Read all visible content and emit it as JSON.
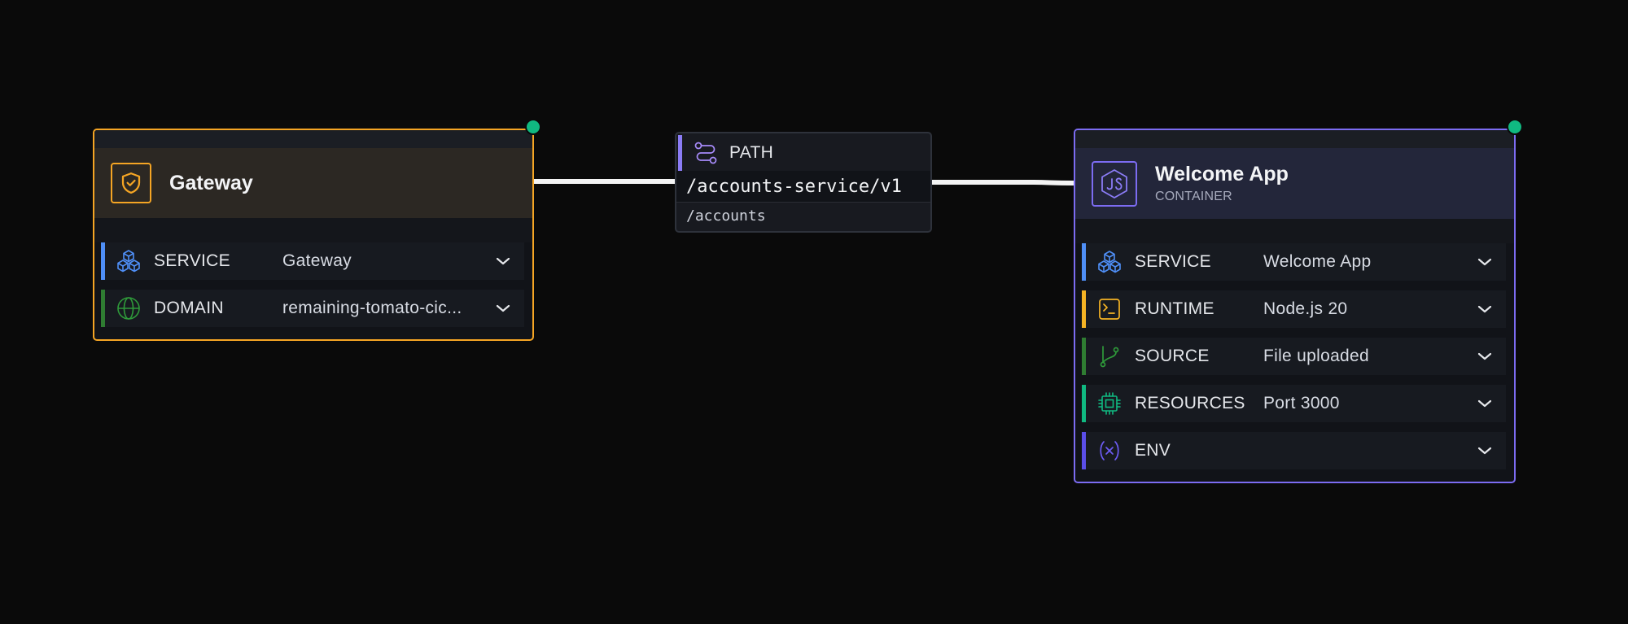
{
  "gateway": {
    "title": "Gateway",
    "accent": "#f5a524",
    "icon": "shield-check-icon",
    "rows": [
      {
        "label": "SERVICE",
        "value": "Gateway",
        "icon": "cubes-icon",
        "color": "#4f8ff7"
      },
      {
        "label": "DOMAIN",
        "value": "remaining-tomato-cic...",
        "icon": "globe-icon",
        "color": "#2f7d32"
      }
    ]
  },
  "path": {
    "label": "PATH",
    "icon": "route-icon",
    "accent": "#8b7cf6",
    "primary": "/accounts-service/v1",
    "secondary": "/accounts"
  },
  "app": {
    "title": "Welcome App",
    "subtitle": "CONTAINER",
    "accent": "#7c6cf2",
    "icon": "js-hexagon-icon",
    "rows": [
      {
        "label": "SERVICE",
        "value": "Welcome App",
        "icon": "cubes-icon",
        "color": "#4f8ff7"
      },
      {
        "label": "RUNTIME",
        "value": "Node.js 20",
        "icon": "terminal-icon",
        "color": "#f5b324"
      },
      {
        "label": "SOURCE",
        "value": "File uploaded",
        "icon": "git-branch-icon",
        "color": "#2f7d32"
      },
      {
        "label": "RESOURCES",
        "value": "Port 3000",
        "icon": "cpu-chip-icon",
        "color": "#10b981"
      },
      {
        "label": "ENV",
        "value": "",
        "icon": "variable-icon",
        "color": "#5b4ee8"
      }
    ]
  },
  "status": {
    "handle_color": "#10b981"
  }
}
